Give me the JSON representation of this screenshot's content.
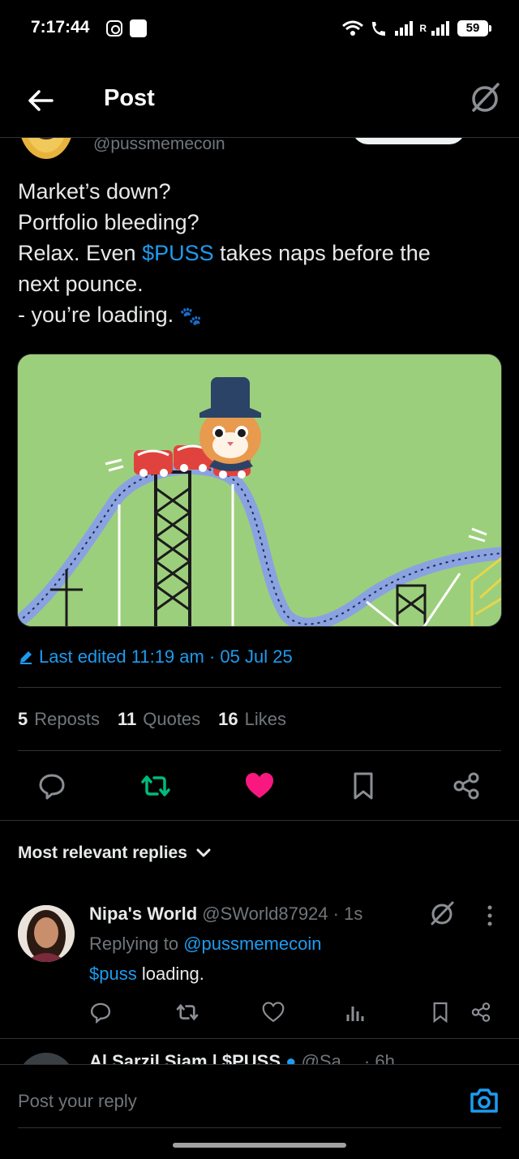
{
  "status_bar": {
    "time": "7:17:44",
    "roaming_label": "R",
    "battery": "59"
  },
  "header": {
    "title": "Post"
  },
  "post": {
    "author_handle": "@pussmemecoin",
    "text_lines": [
      [
        "Market’s down?"
      ],
      [
        "Portfolio bleeding?"
      ],
      [
        "Relax. Even ",
        "$PUSS",
        " takes naps before the"
      ],
      [
        "next pounce."
      ],
      [
        "- you’re loading. ",
        "🐾"
      ]
    ],
    "line1": "Market’s down?",
    "line2": "Portfolio bleeding?",
    "line3_pre": "Relax. Even ",
    "line3_tag": "$PUSS",
    "line3_post": " takes naps before the",
    "line4": "next pounce.",
    "line5": "- you’re loading. ",
    "line5_emoji": "🐾",
    "edited_label": "Last edited 11:19 am · 05 Jul 25",
    "stats": {
      "reposts_count": "5",
      "reposts_label": "Reposts",
      "quotes_count": "11",
      "quotes_label": "Quotes",
      "likes_count": "16",
      "likes_label": "Likes"
    },
    "liked": true
  },
  "replies_section": {
    "sort_label": "Most relevant replies"
  },
  "replies": [
    {
      "name": "Nipa's World",
      "handle_time": "@SWorld87924 · 1s",
      "replying_prefix": "Replying to ",
      "replying_to": "@pussmemecoin",
      "text_tag": "$puss",
      "text_rest": " loading."
    },
    {
      "name": "Al Sarzil Siam | $PUSS",
      "handle_time": "@Sa…  · 6h"
    }
  ],
  "composer": {
    "placeholder": "Post your reply"
  },
  "colors": {
    "accent": "#1d9bf0",
    "repost_green": "#00ba7c",
    "like_pink": "#f91880",
    "image_bg": "#9ccf7c"
  },
  "icons": [
    "back-arrow-icon",
    "grok-icon",
    "reply-icon",
    "repost-icon",
    "heart-icon",
    "bookmark-icon",
    "share-icon",
    "chevron-down-icon",
    "more-icon",
    "views-icon",
    "camera-icon",
    "pencil-icon",
    "paw-icon"
  ]
}
